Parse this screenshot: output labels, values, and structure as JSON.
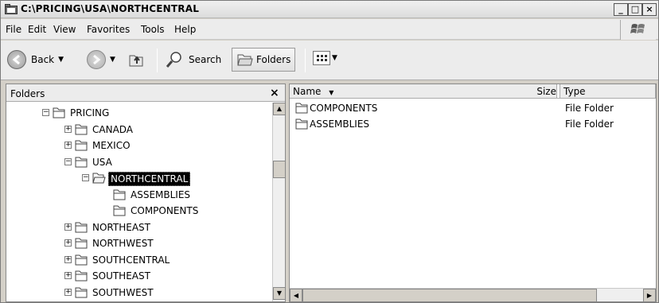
{
  "window": {
    "title": "C:\\PRICING\\USA\\NORTHCENTRAL"
  },
  "menu": [
    "File",
    "Edit",
    "View",
    "Favorites",
    "Tools",
    "Help"
  ],
  "toolbar": {
    "back_label": "Back",
    "search_label": "Search",
    "folders_label": "Folders"
  },
  "folders_panel": {
    "title": "Folders",
    "close_glyph": "×",
    "nodes": [
      {
        "label": "PRICING",
        "expander": "−",
        "selected": false
      },
      {
        "label": "CANADA",
        "expander": "+",
        "selected": false
      },
      {
        "label": "MEXICO",
        "expander": "+",
        "selected": false
      },
      {
        "label": "USA",
        "expander": "−",
        "selected": false
      },
      {
        "label": "NORTHCENTRAL",
        "expander": "−",
        "selected": true
      },
      {
        "label": "ASSEMBLIES",
        "expander": "",
        "selected": false
      },
      {
        "label": "COMPONENTS",
        "expander": "",
        "selected": false
      },
      {
        "label": "NORTHEAST",
        "expander": "+",
        "selected": false
      },
      {
        "label": "NORTHWEST",
        "expander": "+",
        "selected": false
      },
      {
        "label": "SOUTHCENTRAL",
        "expander": "+",
        "selected": false
      },
      {
        "label": "SOUTHEAST",
        "expander": "+",
        "selected": false
      },
      {
        "label": "SOUTHWEST",
        "expander": "+",
        "selected": false
      }
    ]
  },
  "file_list": {
    "columns": {
      "name": "Name",
      "size": "Size",
      "type": "Type"
    },
    "rows": [
      {
        "name": "COMPONENTS",
        "size": "",
        "type": "File Folder"
      },
      {
        "name": "ASSEMBLIES",
        "size": "",
        "type": "File Folder"
      }
    ]
  }
}
